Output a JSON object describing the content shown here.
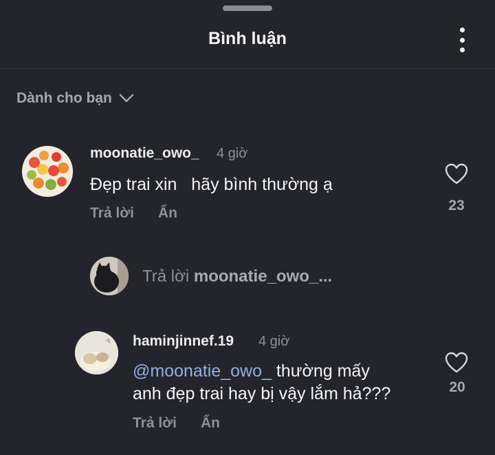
{
  "header": {
    "title": "Bình luận",
    "more_icon": "more-vertical-icon"
  },
  "filter": {
    "label": "Dành cho bạn",
    "icon": "chevron-down-icon"
  },
  "comments": [
    {
      "username": "moonatie_owo_",
      "time": "4 giờ",
      "text": "Đẹp trai xin   hãy bình thường ạ",
      "reply_label": "Trả lời",
      "hide_label": "Ẩn",
      "likes": "23",
      "like_icon": "heart-outline-icon"
    }
  ],
  "reply_prompt": {
    "prefix": "Trả lời",
    "target": "moonatie_owo_..."
  },
  "replies": [
    {
      "username": "haminjinnef.19",
      "time": "4 giờ",
      "mention": "@moonatie_owo_",
      "text_line1": " thường mấy",
      "text_line2": "anh đẹp trai hay bị vậy lắm hả???",
      "reply_label": "Trả lời",
      "hide_label": "Ẩn",
      "likes": "20",
      "like_icon": "heart-outline-icon"
    }
  ],
  "colors": {
    "background": "#24252c",
    "mention": "#8fb0e6",
    "muted_text": "#8f9096"
  }
}
